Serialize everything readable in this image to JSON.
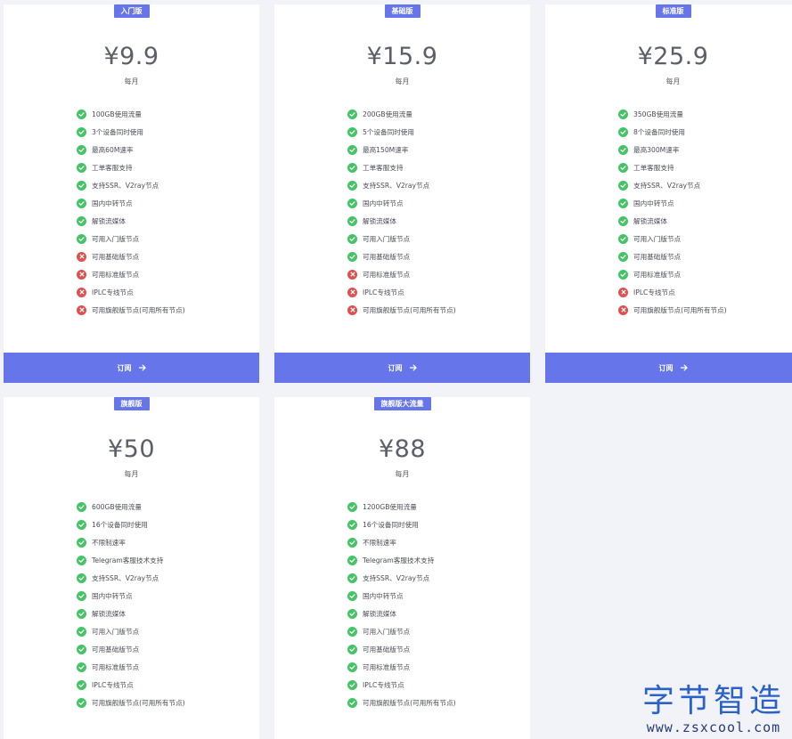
{
  "plans": [
    {
      "badge": "入门版",
      "price": "¥9.9",
      "period": "每月",
      "button": "订阅",
      "features": [
        {
          "text": "100GB使用流量",
          "included": true
        },
        {
          "text": "3个设备同时使用",
          "included": true
        },
        {
          "text": "最高60M速率",
          "included": true
        },
        {
          "text": "工单客服支持",
          "included": true
        },
        {
          "text": "支持SSR、V2ray节点",
          "included": true
        },
        {
          "text": "国内中转节点",
          "included": true
        },
        {
          "text": "解锁流媒体",
          "included": true
        },
        {
          "text": "可用入门版节点",
          "included": true
        },
        {
          "text": "可用基础版节点",
          "included": false
        },
        {
          "text": "可用标准版节点",
          "included": false
        },
        {
          "text": "IPLC专线节点",
          "included": false
        },
        {
          "text": "可用旗舰版节点(可用所有节点)",
          "included": false
        }
      ]
    },
    {
      "badge": "基础版",
      "price": "¥15.9",
      "period": "每月",
      "button": "订阅",
      "features": [
        {
          "text": "200GB使用流量",
          "included": true
        },
        {
          "text": "5个设备同时使用",
          "included": true
        },
        {
          "text": "最高150M速率",
          "included": true
        },
        {
          "text": "工单客服支持",
          "included": true
        },
        {
          "text": "支持SSR、V2ray节点",
          "included": true
        },
        {
          "text": "国内中转节点",
          "included": true
        },
        {
          "text": "解锁流媒体",
          "included": true
        },
        {
          "text": "可用入门版节点",
          "included": true
        },
        {
          "text": "可用基础版节点",
          "included": true
        },
        {
          "text": "可用标准版节点",
          "included": false
        },
        {
          "text": "IPLC专线节点",
          "included": false
        },
        {
          "text": "可用旗舰版节点(可用所有节点)",
          "included": false
        }
      ]
    },
    {
      "badge": "标准版",
      "price": "¥25.9",
      "period": "每月",
      "button": "订阅",
      "features": [
        {
          "text": "350GB使用流量",
          "included": true
        },
        {
          "text": "8个设备同时使用",
          "included": true
        },
        {
          "text": "最高300M速率",
          "included": true
        },
        {
          "text": "工单客服支持",
          "included": true
        },
        {
          "text": "支持SSR、V2ray节点",
          "included": true
        },
        {
          "text": "国内中转节点",
          "included": true
        },
        {
          "text": "解锁流媒体",
          "included": true
        },
        {
          "text": "可用入门版节点",
          "included": true
        },
        {
          "text": "可用基础版节点",
          "included": true
        },
        {
          "text": "可用标准版节点",
          "included": true
        },
        {
          "text": "IPLC专线节点",
          "included": false
        },
        {
          "text": "可用旗舰版节点(可用所有节点)",
          "included": false
        }
      ]
    },
    {
      "badge": "旗舰版",
      "price": "¥50",
      "period": "每月",
      "button": "",
      "features": [
        {
          "text": "600GB使用流量",
          "included": true
        },
        {
          "text": "16个设备同时使用",
          "included": true
        },
        {
          "text": "不限制速率",
          "included": true
        },
        {
          "text": "Telegram客服技术支持",
          "included": true
        },
        {
          "text": "支持SSR、V2ray节点",
          "included": true
        },
        {
          "text": "国内中转节点",
          "included": true
        },
        {
          "text": "解锁流媒体",
          "included": true
        },
        {
          "text": "可用入门版节点",
          "included": true
        },
        {
          "text": "可用基础版节点",
          "included": true
        },
        {
          "text": "可用标准版节点",
          "included": true
        },
        {
          "text": "IPLC专线节点",
          "included": true
        },
        {
          "text": "可用旗舰版节点(可用所有节点)",
          "included": true
        }
      ]
    },
    {
      "badge": "旗舰版大流量",
      "price": "¥88",
      "period": "每月",
      "button": "",
      "features": [
        {
          "text": "1200GB使用流量",
          "included": true
        },
        {
          "text": "16个设备同时使用",
          "included": true
        },
        {
          "text": "不限制速率",
          "included": true
        },
        {
          "text": "Telegram客服技术支持",
          "included": true
        },
        {
          "text": "支持SSR、V2ray节点",
          "included": true
        },
        {
          "text": "国内中转节点",
          "included": true
        },
        {
          "text": "解锁流媒体",
          "included": true
        },
        {
          "text": "可用入门版节点",
          "included": true
        },
        {
          "text": "可用基础版节点",
          "included": true
        },
        {
          "text": "可用标准版节点",
          "included": true
        },
        {
          "text": "IPLC专线节点",
          "included": true
        },
        {
          "text": "可用旗舰版节点(可用所有节点)",
          "included": true
        }
      ]
    }
  ],
  "watermark": {
    "title": "字节智造",
    "url": "www.zsxcool.com"
  },
  "colors": {
    "accent": "#6675ea",
    "included": "#45c467",
    "excluded": "#e04f4f",
    "background": "#f2f3f8"
  },
  "icons": {
    "included": "check-circle-icon",
    "excluded": "x-circle-icon",
    "button": "arrow-right-icon"
  }
}
